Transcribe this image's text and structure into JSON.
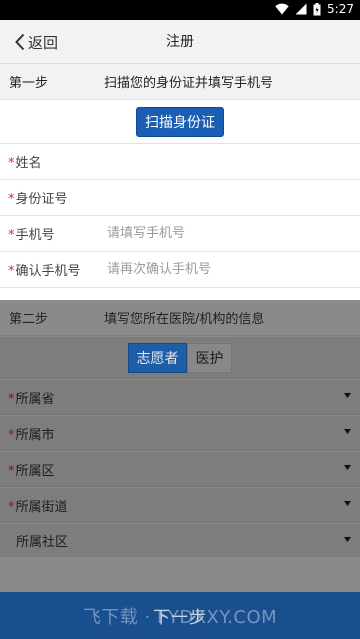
{
  "status_bar": {
    "time": "5:27"
  },
  "nav": {
    "back_label": "返回",
    "title": "注册"
  },
  "step1": {
    "label": "第一步",
    "desc": "扫描您的身份证并填写手机号"
  },
  "scan_button": "扫描身份证",
  "fields": [
    {
      "label": "姓名",
      "required": "*",
      "value": "",
      "placeholder": ""
    },
    {
      "label": "身份证号",
      "required": "*",
      "value": "",
      "placeholder": ""
    },
    {
      "label": "手机号",
      "required": "*",
      "value": "",
      "placeholder": "请填写手机号"
    },
    {
      "label": "确认手机号",
      "required": "*",
      "value": "",
      "placeholder": "请再次确认手机号"
    }
  ],
  "step2": {
    "label": "第二步",
    "desc": "填写您所在医院/机构的信息"
  },
  "role_toggle": {
    "options": [
      "志愿者",
      "医护"
    ],
    "selected": "志愿者"
  },
  "selects": [
    {
      "label": "所属省",
      "required": "*",
      "value": ""
    },
    {
      "label": "所属市",
      "required": "*",
      "value": ""
    },
    {
      "label": "所属区",
      "required": "*",
      "value": ""
    },
    {
      "label": "所属街道",
      "required": "*",
      "value": ""
    },
    {
      "label": "所属社区",
      "required": "",
      "value": ""
    }
  ],
  "next_button": "下一步",
  "watermark": "飞下载 · FYDXXY.COM",
  "colors": {
    "primary": "#1a5fb4",
    "required": "#e22222",
    "overlay": "#8c8c8c",
    "bottom_bar": "#1a4f8f"
  }
}
